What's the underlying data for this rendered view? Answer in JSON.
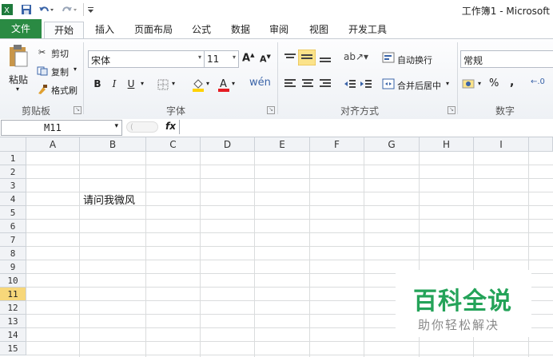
{
  "window": {
    "title": "工作簿1 - Microsoft"
  },
  "tabs": [
    {
      "label": "文件"
    },
    {
      "label": "开始"
    },
    {
      "label": "插入"
    },
    {
      "label": "页面布局"
    },
    {
      "label": "公式"
    },
    {
      "label": "数据"
    },
    {
      "label": "审阅"
    },
    {
      "label": "视图"
    },
    {
      "label": "开发工具"
    }
  ],
  "clipboard": {
    "group": "剪贴板",
    "paste": "粘贴",
    "cut": "剪切",
    "copy": "复制",
    "painter": "格式刷"
  },
  "font": {
    "group": "字体",
    "name": "宋体",
    "size": "11",
    "bold": "B",
    "italic": "I",
    "underline": "U"
  },
  "alignment": {
    "group": "对齐方式",
    "wrap": "自动换行",
    "merge": "合并后居中"
  },
  "number": {
    "group": "数字",
    "format": "常规",
    "percent": "%",
    "comma": ","
  },
  "formula_bar": {
    "name_box": "M11",
    "fx": "fx",
    "value": ""
  },
  "columns": [
    "A",
    "B",
    "C",
    "D",
    "E",
    "F",
    "G",
    "H",
    "I"
  ],
  "rows": [
    "1",
    "2",
    "3",
    "4",
    "5",
    "6",
    "7",
    "8",
    "9",
    "10",
    "11",
    "12",
    "13",
    "14",
    "15"
  ],
  "selected_row": "11",
  "cells": {
    "B4": "请问我微风"
  },
  "watermark": {
    "title": "百科全说",
    "subtitle": "助你轻松解决"
  },
  "colors": {
    "file_tab": "#2a8a43",
    "selected_header": "#f7d77a",
    "watermark": "#24a359"
  }
}
